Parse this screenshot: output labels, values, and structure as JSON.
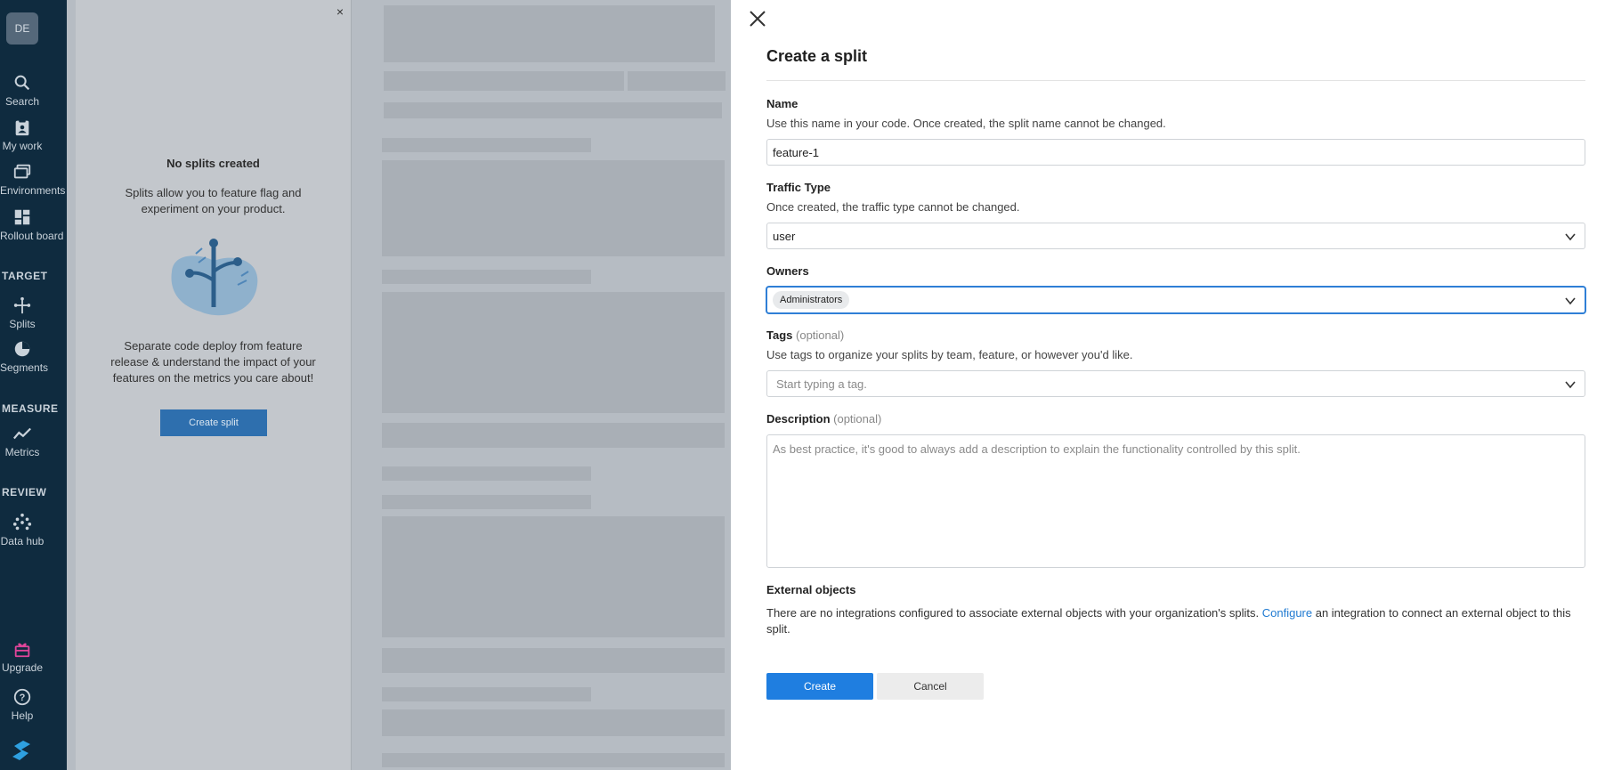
{
  "nav": {
    "avatar": "DE",
    "items": [
      {
        "label": "Search"
      },
      {
        "label": "My work"
      },
      {
        "label": "Environments"
      },
      {
        "label": "Rollout board"
      },
      {
        "label": "Splits"
      },
      {
        "label": "Segments"
      },
      {
        "label": "Metrics"
      },
      {
        "label": "Data hub"
      },
      {
        "label": "Upgrade"
      },
      {
        "label": "Help"
      }
    ],
    "sections": {
      "target": "TARGET",
      "measure": "MEASURE",
      "review": "REVIEW"
    },
    "upgrade_color": "#e0459a"
  },
  "empty_state": {
    "close": "×",
    "title": "No splits created",
    "description": "Splits allow you to feature flag and experiment on your product.",
    "description2": "Separate code deploy from feature release & understand the impact of your features on the metrics you care about!",
    "button": "Create split"
  },
  "drawer": {
    "title": "Create a split",
    "name": {
      "label": "Name",
      "help": "Use this name in your code. Once created, the split name cannot be changed.",
      "value": "feature-1"
    },
    "traffic_type": {
      "label": "Traffic Type",
      "help": "Once created, the traffic type cannot be changed.",
      "value": "user"
    },
    "owners": {
      "label": "Owners",
      "chip": "Administrators"
    },
    "tags": {
      "label": "Tags",
      "optional": "(optional)",
      "help": "Use tags to organize your splits by team, feature, or however you'd like.",
      "placeholder": "Start typing a tag."
    },
    "description": {
      "label": "Description",
      "optional": "(optional)",
      "placeholder": "As best practice, it's good to always add a description to explain the functionality controlled by this split."
    },
    "external": {
      "label": "External objects",
      "text_before": "There are no integrations configured to associate external objects with your organization's splits. ",
      "link": "Configure",
      "text_after": " an integration to connect an external object to this split."
    },
    "create_button": "Create",
    "cancel_button": "Cancel"
  },
  "colors": {
    "accent": "#1f7ee0",
    "rail": "#0f2b3f"
  }
}
